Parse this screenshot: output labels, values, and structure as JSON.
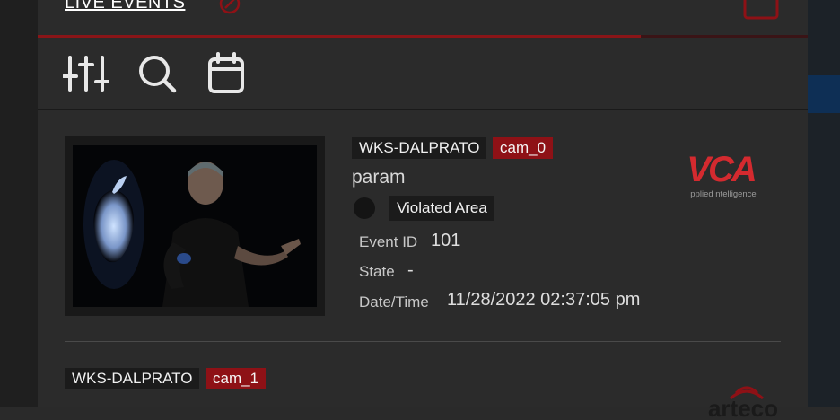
{
  "header": {
    "title": "LIVE EVENTS"
  },
  "toolbar": {
    "filters": "sliders-icon",
    "search": "search-icon",
    "calendar": "calendar-icon"
  },
  "events": [
    {
      "host": "WKS-DALPRATO",
      "camera": "cam_0",
      "param": "param",
      "type": "Violated Area",
      "labels": {
        "event_id": "Event ID",
        "state": "State",
        "datetime": "Date/Time"
      },
      "event_id": "101",
      "state": "-",
      "datetime": "11/28/2022 02:37:05 pm",
      "logo": {
        "main": "VCA",
        "tagline": "pplied ntelligence"
      }
    },
    {
      "host": "WKS-DALPRATO",
      "camera": "cam_1",
      "logo": {
        "main": "arteco"
      }
    }
  ],
  "colors": {
    "accent": "#8e1116",
    "panel": "#2b2b2b",
    "rule": "#8a1518"
  }
}
